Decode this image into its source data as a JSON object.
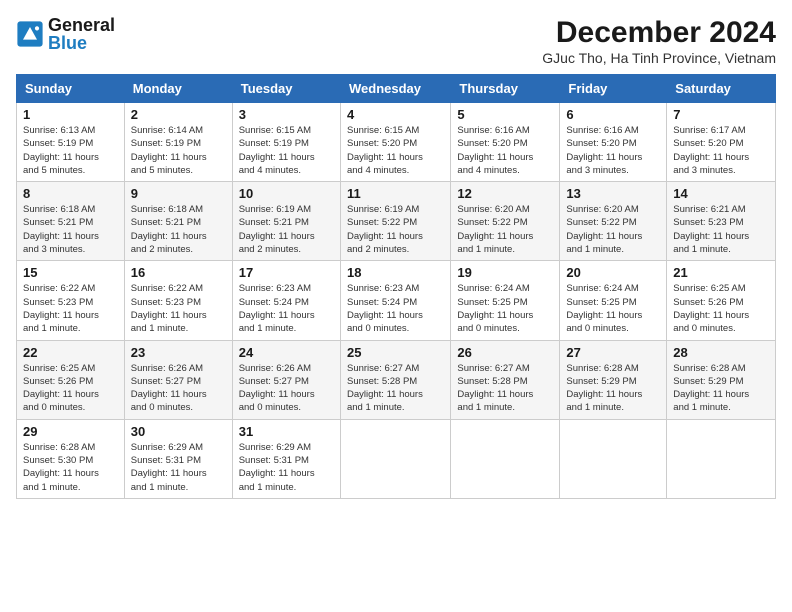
{
  "logo": {
    "line1": "General",
    "line2": "Blue"
  },
  "title": "December 2024",
  "subtitle": "GJuc Tho, Ha Tinh Province, Vietnam",
  "days_of_week": [
    "Sunday",
    "Monday",
    "Tuesday",
    "Wednesday",
    "Thursday",
    "Friday",
    "Saturday"
  ],
  "weeks": [
    [
      {
        "day": 1,
        "info": "Sunrise: 6:13 AM\nSunset: 5:19 PM\nDaylight: 11 hours\nand 5 minutes."
      },
      {
        "day": 2,
        "info": "Sunrise: 6:14 AM\nSunset: 5:19 PM\nDaylight: 11 hours\nand 5 minutes."
      },
      {
        "day": 3,
        "info": "Sunrise: 6:15 AM\nSunset: 5:19 PM\nDaylight: 11 hours\nand 4 minutes."
      },
      {
        "day": 4,
        "info": "Sunrise: 6:15 AM\nSunset: 5:20 PM\nDaylight: 11 hours\nand 4 minutes."
      },
      {
        "day": 5,
        "info": "Sunrise: 6:16 AM\nSunset: 5:20 PM\nDaylight: 11 hours\nand 4 minutes."
      },
      {
        "day": 6,
        "info": "Sunrise: 6:16 AM\nSunset: 5:20 PM\nDaylight: 11 hours\nand 3 minutes."
      },
      {
        "day": 7,
        "info": "Sunrise: 6:17 AM\nSunset: 5:20 PM\nDaylight: 11 hours\nand 3 minutes."
      }
    ],
    [
      {
        "day": 8,
        "info": "Sunrise: 6:18 AM\nSunset: 5:21 PM\nDaylight: 11 hours\nand 3 minutes."
      },
      {
        "day": 9,
        "info": "Sunrise: 6:18 AM\nSunset: 5:21 PM\nDaylight: 11 hours\nand 2 minutes."
      },
      {
        "day": 10,
        "info": "Sunrise: 6:19 AM\nSunset: 5:21 PM\nDaylight: 11 hours\nand 2 minutes."
      },
      {
        "day": 11,
        "info": "Sunrise: 6:19 AM\nSunset: 5:22 PM\nDaylight: 11 hours\nand 2 minutes."
      },
      {
        "day": 12,
        "info": "Sunrise: 6:20 AM\nSunset: 5:22 PM\nDaylight: 11 hours\nand 1 minute."
      },
      {
        "day": 13,
        "info": "Sunrise: 6:20 AM\nSunset: 5:22 PM\nDaylight: 11 hours\nand 1 minute."
      },
      {
        "day": 14,
        "info": "Sunrise: 6:21 AM\nSunset: 5:23 PM\nDaylight: 11 hours\nand 1 minute."
      }
    ],
    [
      {
        "day": 15,
        "info": "Sunrise: 6:22 AM\nSunset: 5:23 PM\nDaylight: 11 hours\nand 1 minute."
      },
      {
        "day": 16,
        "info": "Sunrise: 6:22 AM\nSunset: 5:23 PM\nDaylight: 11 hours\nand 1 minute."
      },
      {
        "day": 17,
        "info": "Sunrise: 6:23 AM\nSunset: 5:24 PM\nDaylight: 11 hours\nand 1 minute."
      },
      {
        "day": 18,
        "info": "Sunrise: 6:23 AM\nSunset: 5:24 PM\nDaylight: 11 hours\nand 0 minutes."
      },
      {
        "day": 19,
        "info": "Sunrise: 6:24 AM\nSunset: 5:25 PM\nDaylight: 11 hours\nand 0 minutes."
      },
      {
        "day": 20,
        "info": "Sunrise: 6:24 AM\nSunset: 5:25 PM\nDaylight: 11 hours\nand 0 minutes."
      },
      {
        "day": 21,
        "info": "Sunrise: 6:25 AM\nSunset: 5:26 PM\nDaylight: 11 hours\nand 0 minutes."
      }
    ],
    [
      {
        "day": 22,
        "info": "Sunrise: 6:25 AM\nSunset: 5:26 PM\nDaylight: 11 hours\nand 0 minutes."
      },
      {
        "day": 23,
        "info": "Sunrise: 6:26 AM\nSunset: 5:27 PM\nDaylight: 11 hours\nand 0 minutes."
      },
      {
        "day": 24,
        "info": "Sunrise: 6:26 AM\nSunset: 5:27 PM\nDaylight: 11 hours\nand 0 minutes."
      },
      {
        "day": 25,
        "info": "Sunrise: 6:27 AM\nSunset: 5:28 PM\nDaylight: 11 hours\nand 1 minute."
      },
      {
        "day": 26,
        "info": "Sunrise: 6:27 AM\nSunset: 5:28 PM\nDaylight: 11 hours\nand 1 minute."
      },
      {
        "day": 27,
        "info": "Sunrise: 6:28 AM\nSunset: 5:29 PM\nDaylight: 11 hours\nand 1 minute."
      },
      {
        "day": 28,
        "info": "Sunrise: 6:28 AM\nSunset: 5:29 PM\nDaylight: 11 hours\nand 1 minute."
      }
    ],
    [
      {
        "day": 29,
        "info": "Sunrise: 6:28 AM\nSunset: 5:30 PM\nDaylight: 11 hours\nand 1 minute."
      },
      {
        "day": 30,
        "info": "Sunrise: 6:29 AM\nSunset: 5:31 PM\nDaylight: 11 hours\nand 1 minute."
      },
      {
        "day": 31,
        "info": "Sunrise: 6:29 AM\nSunset: 5:31 PM\nDaylight: 11 hours\nand 1 minute."
      },
      null,
      null,
      null,
      null
    ]
  ]
}
